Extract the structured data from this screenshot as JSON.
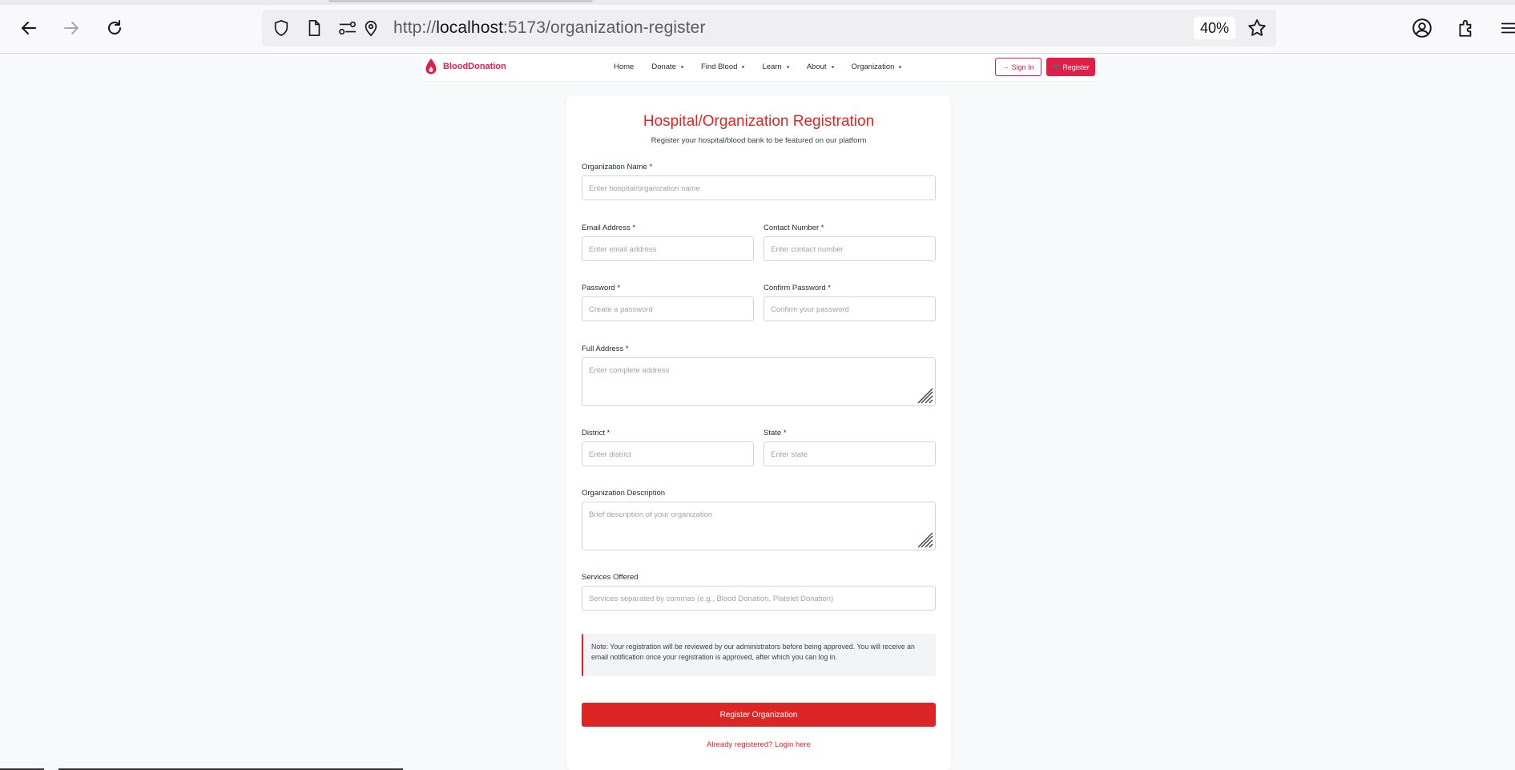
{
  "browser": {
    "url_prefix": "http://",
    "url_host": "localhost",
    "url_rest": ":5173/organization-register",
    "zoom": "40%"
  },
  "site": {
    "brand": "BloodDonation",
    "nav": [
      {
        "label": "Home",
        "dropdown": false
      },
      {
        "label": "Donate",
        "dropdown": true
      },
      {
        "label": "Find Blood",
        "dropdown": true
      },
      {
        "label": "Learn",
        "dropdown": true
      },
      {
        "label": "About",
        "dropdown": true
      },
      {
        "label": "Organization",
        "dropdown": true
      }
    ],
    "sign_in": "Sign In",
    "register": "Register",
    "accent": "#e11d48"
  },
  "form": {
    "title": "Hospital/Organization Registration",
    "subtitle": "Register your hospital/blood bank to be featured on our platform",
    "org_name": {
      "label": "Organization Name *",
      "placeholder": "Enter hospital/organization name"
    },
    "email": {
      "label": "Email Address *",
      "placeholder": "Enter email address"
    },
    "contact": {
      "label": "Contact Number *",
      "placeholder": "Enter contact number"
    },
    "password": {
      "label": "Password *",
      "placeholder": "Create a password"
    },
    "confirm_password": {
      "label": "Confirm Password *",
      "placeholder": "Confirm your password"
    },
    "address": {
      "label": "Full Address *",
      "placeholder": "Enter complete address"
    },
    "district": {
      "label": "District *",
      "placeholder": "Enter district"
    },
    "state": {
      "label": "State *",
      "placeholder": "Enter state"
    },
    "description": {
      "label": "Organization Description",
      "placeholder": "Brief description of your organization"
    },
    "services": {
      "label": "Services Offered",
      "placeholder": "Services separated by commas (e.g., Blood Donation, Platelet Donation)"
    },
    "note": "Note: Your registration will be reviewed by our administrators before being approved. You will receive an email notification once your registration is approved, after which you can log in.",
    "submit": "Register Organization",
    "login_link": "Already registered? Login here",
    "primary_color": "#dc2626"
  }
}
